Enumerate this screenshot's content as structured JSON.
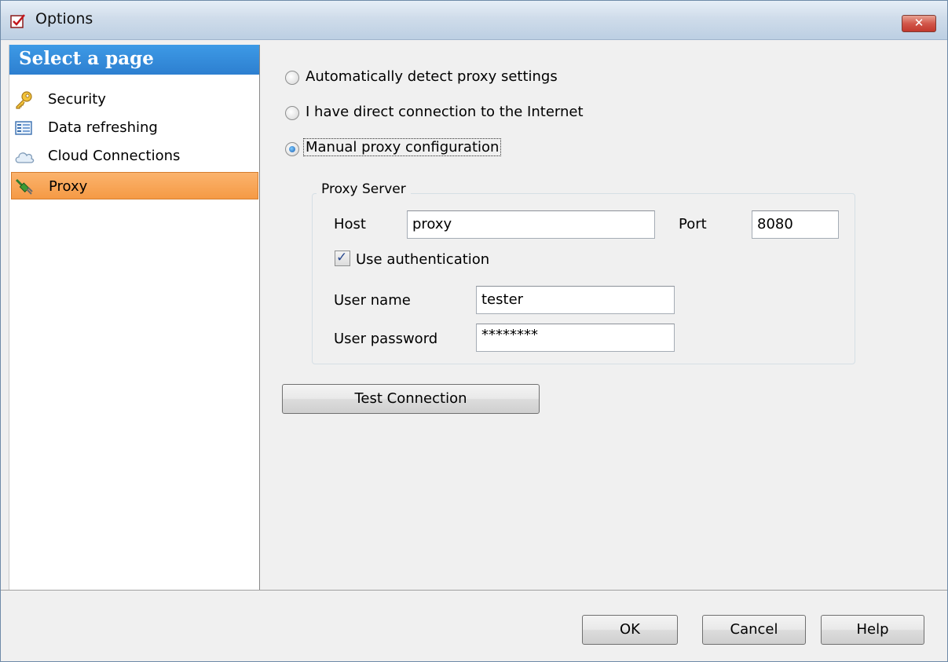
{
  "window": {
    "title": "Options",
    "close_glyph": "✕",
    "app_icon": "checkbox-window-icon"
  },
  "sidebar": {
    "header": "Select a page",
    "items": [
      {
        "label": "Security",
        "icon": "key-icon",
        "selected": false
      },
      {
        "label": "Data refreshing",
        "icon": "table-icon",
        "selected": false
      },
      {
        "label": "Cloud Connections",
        "icon": "cloud-icon",
        "selected": false
      },
      {
        "label": "Proxy",
        "icon": "proxy-plug-icon",
        "selected": true
      }
    ]
  },
  "proxy": {
    "options": [
      {
        "label": "Automatically detect proxy settings",
        "checked": false
      },
      {
        "label": "I have direct connection to the Internet",
        "checked": false
      },
      {
        "label": "Manual proxy configuration",
        "checked": true
      }
    ],
    "group_title": "Proxy Server",
    "host_label": "Host",
    "host_value": "proxy",
    "port_label": "Port",
    "port_value": "8080",
    "use_auth_label": "Use authentication",
    "use_auth_checked": true,
    "user_name_label": "User name",
    "user_name_value": "tester",
    "user_password_label": "User password",
    "user_password_value": "********",
    "test_button": "Test Connection"
  },
  "footer": {
    "ok": "OK",
    "cancel": "Cancel",
    "help": "Help"
  },
  "colors": {
    "nav_header": "#2d7fd0",
    "selected_item": "#f59a45",
    "close_button": "#c2382c"
  }
}
